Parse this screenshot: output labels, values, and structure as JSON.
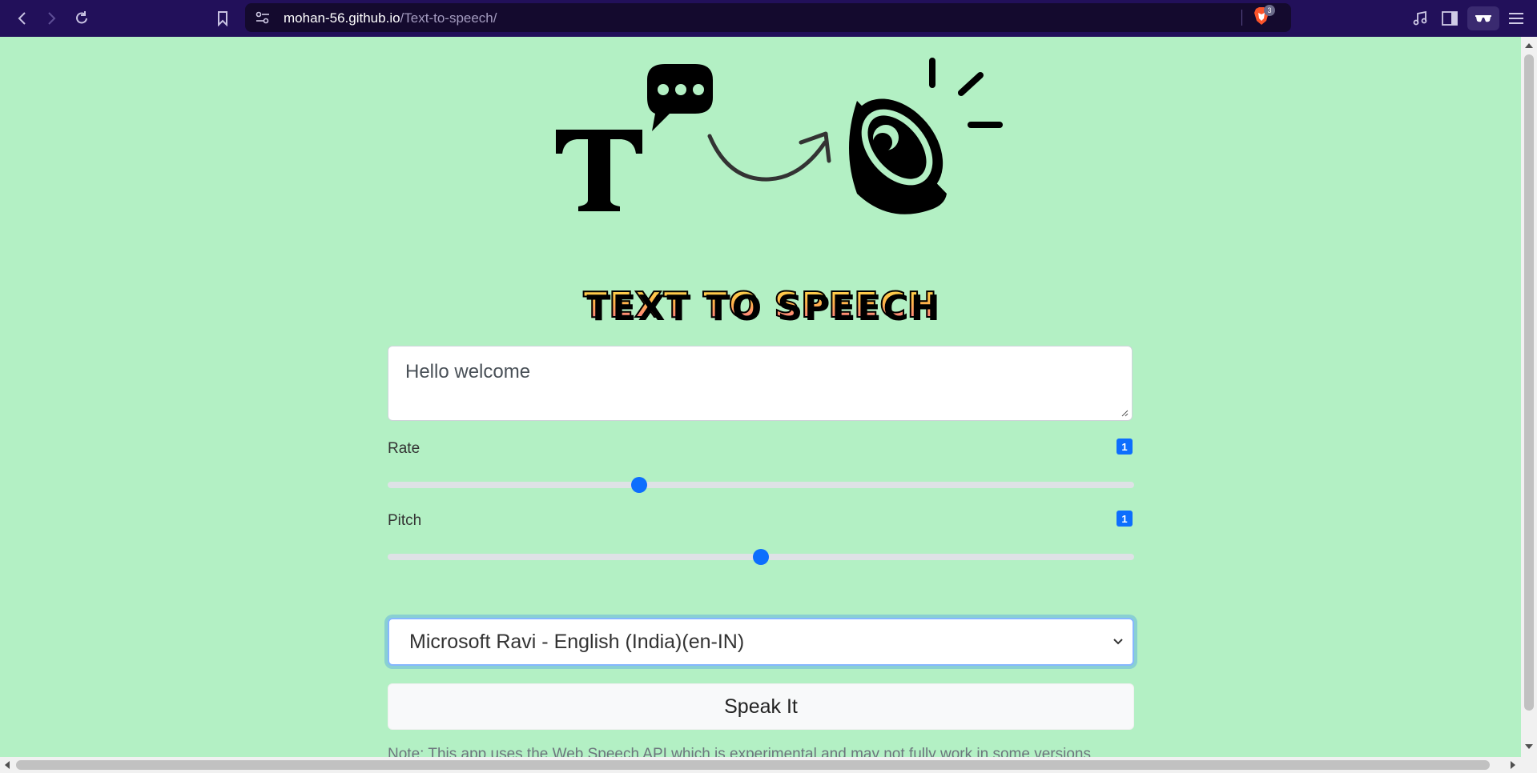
{
  "browser": {
    "url_host": "mohan-56.github.io",
    "url_path": "/Text-to-speech/",
    "shields_count": "3"
  },
  "page": {
    "title": "Text to Speech",
    "textarea_value": "Hello welcome",
    "rate_label": "Rate",
    "rate_value": "1",
    "pitch_label": "Pitch",
    "pitch_value": "1",
    "voice_selected": "Microsoft Ravi - English (India)(en-IN)",
    "speak_button": "Speak It",
    "note": "Note: This app uses the Web Speech API which is experimental and may not fully work in some versions"
  },
  "colors": {
    "background": "#b3f0c4",
    "topbar": "#22105a",
    "accent": "#0d6efd"
  }
}
